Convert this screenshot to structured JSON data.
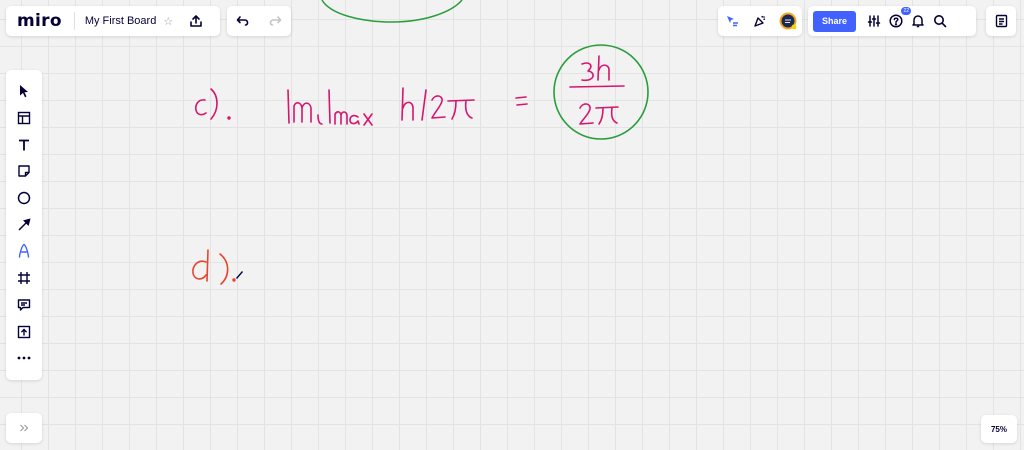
{
  "app": {
    "logo": "miro"
  },
  "board": {
    "title": "My First Board",
    "star_icon": "☆"
  },
  "header": {
    "share_label": "Share",
    "help_badge": "22"
  },
  "zoom": {
    "level": "75%"
  },
  "toolbar": {
    "tools": [
      {
        "name": "select-tool",
        "icon": "cursor-icon"
      },
      {
        "name": "templates-tool",
        "icon": "template-icon"
      },
      {
        "name": "text-tool",
        "icon": "text-icon"
      },
      {
        "name": "sticky-note-tool",
        "icon": "sticky-note-icon"
      },
      {
        "name": "shape-tool",
        "icon": "circle-icon"
      },
      {
        "name": "connection-line-tool",
        "icon": "arrow-icon"
      },
      {
        "name": "pen-tool",
        "icon": "pen-icon"
      },
      {
        "name": "frame-tool",
        "icon": "frame-icon"
      },
      {
        "name": "comment-tool",
        "icon": "comment-icon"
      },
      {
        "name": "upload-tool",
        "icon": "upload-icon"
      },
      {
        "name": "more-tools",
        "icon": "more-icon"
      }
    ]
  },
  "colors": {
    "accent": "#4262ff",
    "ink_magenta": "#d6156e",
    "ink_green": "#2a9d3c",
    "ink_red": "#e8432c",
    "toolbar_icon": "#050038"
  },
  "canvas": {
    "part_c": {
      "label": "c).",
      "expression": "|m_l|max h/2π",
      "equals": "=",
      "answer_numerator": "3h",
      "answer_denominator": "2π"
    },
    "part_d": {
      "label": "d),"
    }
  }
}
